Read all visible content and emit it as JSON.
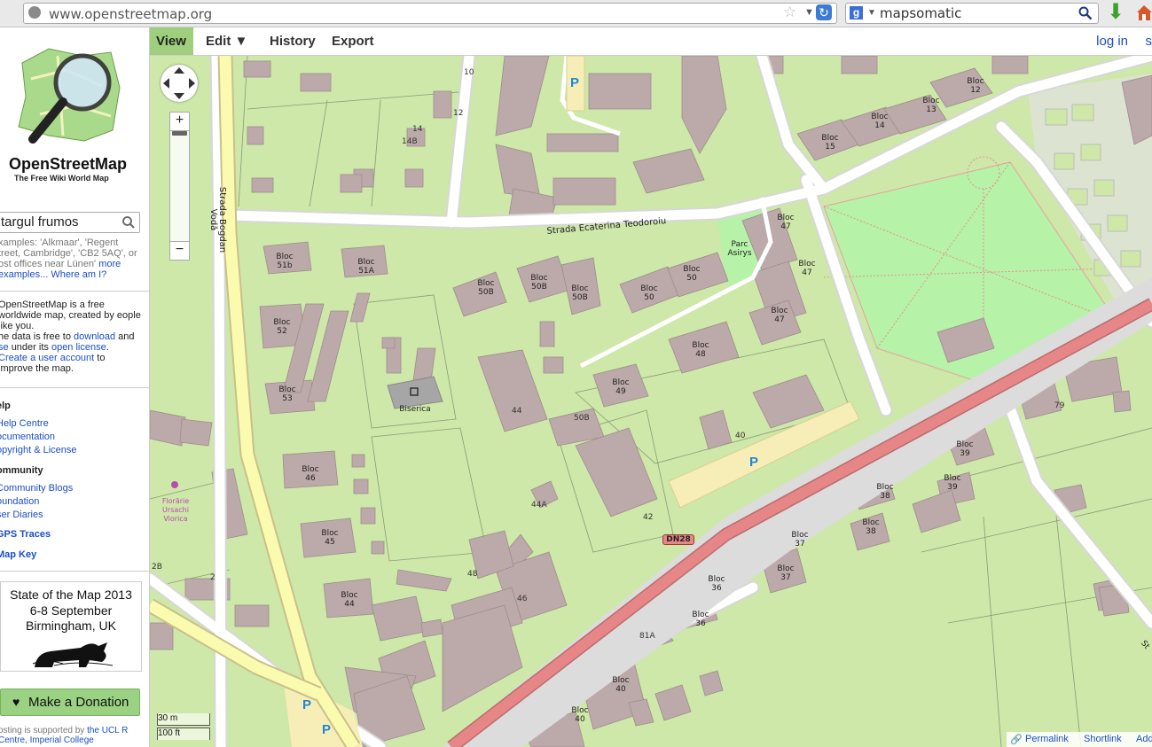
{
  "browser": {
    "url": "www.openstreetmap.org",
    "search_engine_query": "mapsomatic"
  },
  "header": {
    "tabs": {
      "view": "View",
      "edit": "Edit ▼",
      "history": "History",
      "export": "Export"
    },
    "login": "log in",
    "signup": "s"
  },
  "sidebar": {
    "site_title": "OpenStreetMap",
    "site_tagline": "The Free Wiki World Map",
    "search_value": "targul frumos",
    "examples_text": "xamples: 'Alkmaar', 'Regent treet, Cambridge', 'CB2 5AQ', or ost offices near Lünen'",
    "examples_more": "more examples...",
    "where_am_i": "Where am I?",
    "intro_1": "OpenStreetMap is a free worldwide map, created by eople like you.",
    "intro_2a": "he data is free to",
    "intro_download": "download",
    "intro_2b": "and",
    "intro_2c": "se",
    "intro_2d": "under its",
    "intro_license": "open license",
    "intro_create": "Create a user account",
    "intro_3": "to improve the map.",
    "help_heading": "elp",
    "help_centre": "Help Centre",
    "documentation": "ocumentation",
    "copyright": "opyright & License",
    "community_heading": "ommunity",
    "community_blogs": "Community Blogs",
    "foundation": "oundation",
    "user_diaries": "ser Diaries",
    "gps_traces": "GPS Traces",
    "map_key": "Map Key",
    "sotm_title": "State of the Map 2013",
    "sotm_date": "6-8 September",
    "sotm_place": "Birmingham, UK",
    "donate": "Make a Donation",
    "hosting_text": "osting is supported by",
    "hosting_link": "the UCL R Centre, Imperial College"
  },
  "map": {
    "streets": {
      "bogdan_voda": "Strada Bogdan Vodă",
      "ecaterina": "Strada Ecaterina Teodoroiu",
      "dn28": "DN28",
      "st_fragment": "St"
    },
    "buildings": [
      {
        "id": "b1",
        "text": "Bloc 51b"
      },
      {
        "id": "b2",
        "text": "Bloc 51A"
      },
      {
        "id": "b3",
        "text": "Bloc 50B"
      },
      {
        "id": "b4",
        "text": "Bloc 50B"
      },
      {
        "id": "b5",
        "text": "Bloc 50B"
      },
      {
        "id": "b6",
        "text": "Bloc 50"
      },
      {
        "id": "b7",
        "text": "Bloc 50"
      },
      {
        "id": "b8",
        "text": "Bloc 47"
      },
      {
        "id": "b9",
        "text": "Bloc 47"
      },
      {
        "id": "b10",
        "text": "Bloc 47"
      },
      {
        "id": "b11",
        "text": "Bloc 48"
      },
      {
        "id": "b12",
        "text": "Bloc 49"
      },
      {
        "id": "b13",
        "text": "Bloc 52"
      },
      {
        "id": "b14",
        "text": "Bloc 53"
      },
      {
        "id": "b15",
        "text": "Bloc 46"
      },
      {
        "id": "b16",
        "text": "Bloc 45"
      },
      {
        "id": "b17",
        "text": "Bloc 44"
      },
      {
        "id": "b18",
        "text": "Bloc 15"
      },
      {
        "id": "b19",
        "text": "Bloc 14"
      },
      {
        "id": "b20",
        "text": "Bloc 13"
      },
      {
        "id": "b21",
        "text": "Bloc 12"
      },
      {
        "id": "b22",
        "text": "Bloc 39"
      },
      {
        "id": "b23",
        "text": "Bloc 39"
      },
      {
        "id": "b24",
        "text": "Bloc 38"
      },
      {
        "id": "b25",
        "text": "Bloc 38"
      },
      {
        "id": "b26",
        "text": "Bloc 37"
      },
      {
        "id": "b27",
        "text": "Bloc 37"
      },
      {
        "id": "b28",
        "text": "Bloc 36"
      },
      {
        "id": "b29",
        "text": "Bloc 36"
      },
      {
        "id": "b30",
        "text": "Bloc 40"
      },
      {
        "id": "b31",
        "text": "Bloc 40"
      }
    ],
    "poi": {
      "biserica": "Biserica",
      "parc": "Parc Asirys",
      "florarie": "Florărie Ursachi Viorica"
    },
    "numbers": [
      "10",
      "12",
      "14",
      "14B",
      "44",
      "50B",
      "40",
      "42",
      "44A",
      "48",
      "46",
      "2",
      "2B",
      "79",
      "81A"
    ],
    "parking_label": "P",
    "scale_m": "30 m",
    "scale_ft": "100 ft",
    "footer": {
      "permalink": "Permalink",
      "shortlink": "Shortlink",
      "add_note": "Add"
    },
    "zoom_in": "+",
    "zoom_out": "−"
  },
  "colors": {
    "land": "#cde8a8",
    "building": "#bca9a9",
    "road_white": "#ffffff",
    "road_yellow": "#fbfbb0",
    "primary_road": "#e78686",
    "park": "#b6f2a8",
    "tab_active": "#9fcf7d"
  }
}
